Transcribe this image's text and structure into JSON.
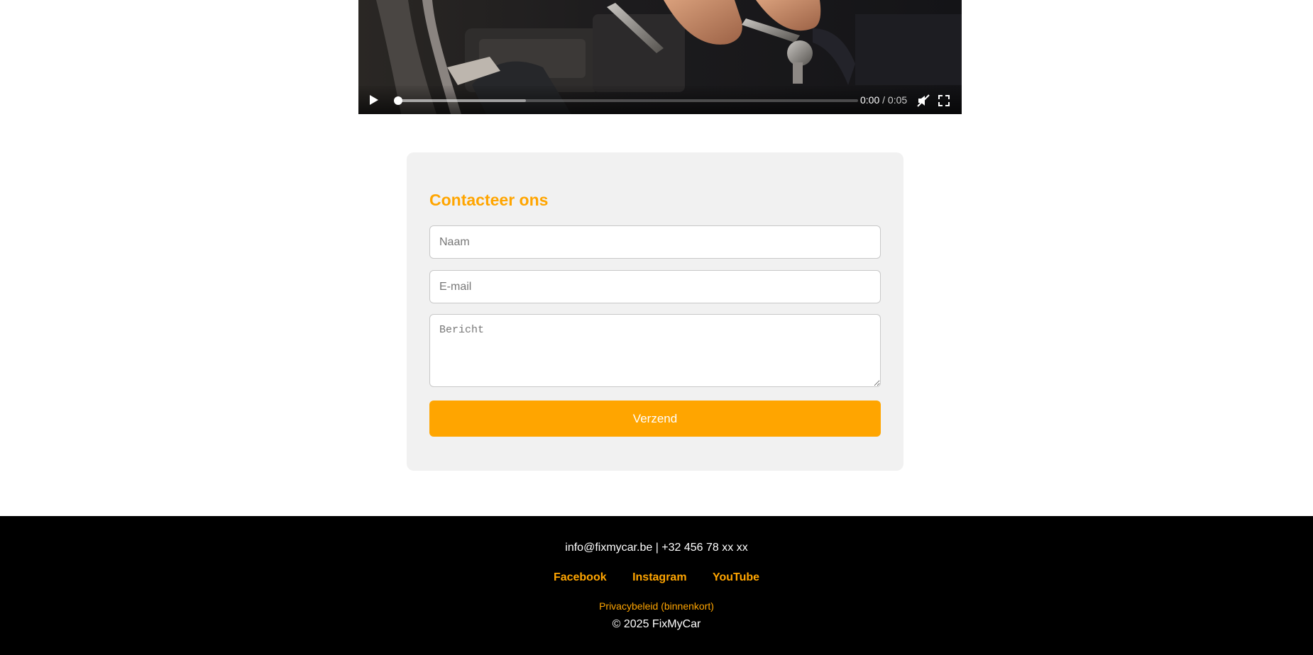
{
  "video": {
    "current_time": "0:00",
    "separator": "/",
    "duration": "0:05",
    "progress_fraction": 0.0,
    "buffered_fraction": 0.28,
    "icons": [
      "play-icon",
      "mute-icon",
      "fullscreen-icon"
    ]
  },
  "contact": {
    "title": "Contacteer ons",
    "name_placeholder": "Naam",
    "email_placeholder": "E-mail",
    "message_placeholder": "Bericht",
    "submit_label": "Verzend"
  },
  "footer": {
    "email": "info@fixmycar.be",
    "divider": "|",
    "phone": "+32 456 78 xx xx",
    "social": [
      {
        "label": "Facebook"
      },
      {
        "label": "Instagram"
      },
      {
        "label": "YouTube"
      }
    ],
    "privacy": "Privacybeleid (binnenkort)",
    "copyright": "© 2025 FixMyCar"
  },
  "colors": {
    "accent": "#ffa500",
    "card_background": "#f1f1f1",
    "footer_background": "#000000"
  }
}
